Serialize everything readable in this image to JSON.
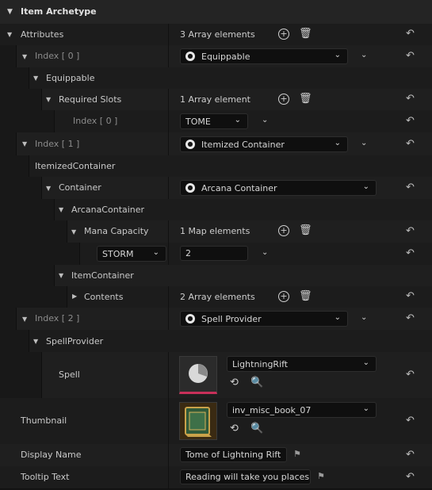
{
  "header": {
    "title": "Item Archetype"
  },
  "rows": {
    "attributes": {
      "label": "Attributes",
      "value": "3 Array elements"
    },
    "index0": {
      "label": "Index [ 0 ]",
      "combo": "Equippable"
    },
    "equippable": {
      "label": "Equippable"
    },
    "required_slots": {
      "label": "Required Slots",
      "value": "1 Array element"
    },
    "rs_index0": {
      "label": "Index [ 0 ]",
      "combo": "TOME"
    },
    "index1": {
      "label": "Index [ 1 ]",
      "combo": "Itemized Container"
    },
    "itemized_container": {
      "label": "ItemizedContainer"
    },
    "container": {
      "label": "Container",
      "combo": "Arcana Container"
    },
    "arcana_container": {
      "label": "ArcanaContainer"
    },
    "mana_capacity": {
      "label": "Mana Capacity",
      "value": "1 Map elements"
    },
    "mana_entry": {
      "key": "STORM",
      "value": "2"
    },
    "item_container": {
      "label": "ItemContainer"
    },
    "contents": {
      "label": "Contents",
      "value": "2 Array elements"
    },
    "index2": {
      "label": "Index [ 2 ]",
      "combo": "Spell Provider"
    },
    "spell_provider": {
      "label": "SpellProvider"
    },
    "spell": {
      "label": "Spell",
      "asset": "LightningRift"
    },
    "thumbnail": {
      "label": "Thumbnail",
      "asset": "inv_misc_book_07"
    },
    "display_name": {
      "label": "Display Name",
      "value": "Tome of Lightning Rift"
    },
    "tooltip_text": {
      "label": "Tooltip Text",
      "value": "Reading will take you places"
    }
  },
  "icons": {
    "add": "plus-circle-icon",
    "delete": "trash-icon",
    "reset": "reset-arrow-icon",
    "browse": "browse-arrow-icon",
    "find": "folder-search-icon",
    "localize": "flag-icon"
  },
  "colors": {
    "background": "#151515",
    "accent": "#c8305a"
  }
}
